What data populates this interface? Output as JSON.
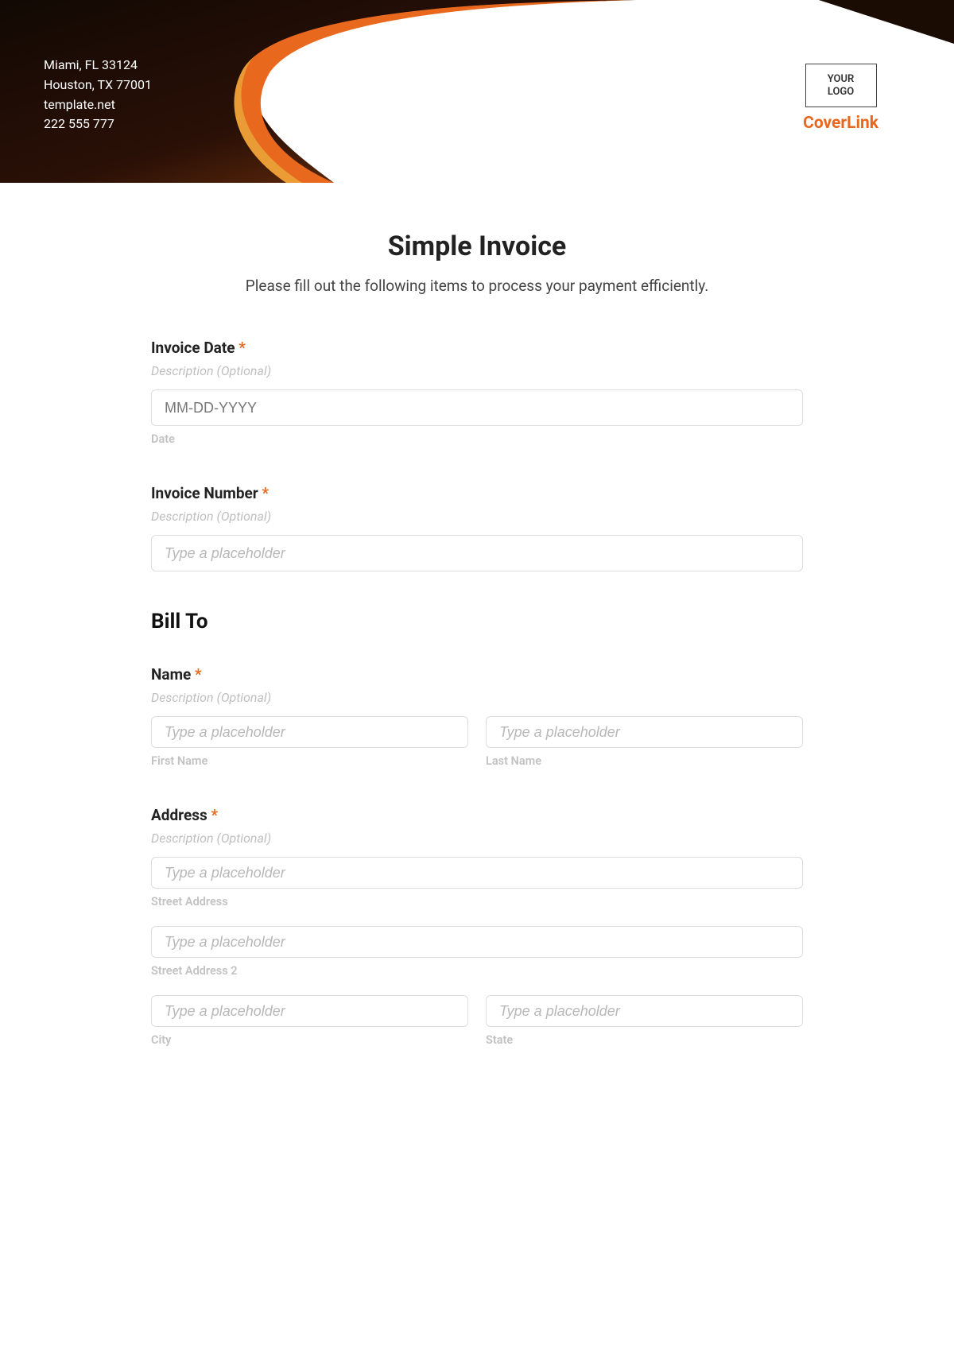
{
  "header": {
    "info_lines": [
      "Miami, FL 33124",
      "Houston, TX 77001",
      "template.net",
      "222 555 777"
    ],
    "logo_text": "YOUR\nLOGO",
    "brand": "CoverLink"
  },
  "form": {
    "title": "Simple Invoice",
    "subtitle": "Please fill out the following items to process your payment efficiently.",
    "invoice_date": {
      "label": "Invoice Date",
      "required": "*",
      "desc": "Description (Optional)",
      "placeholder": "MM-DD-YYYY",
      "sublabel": "Date"
    },
    "invoice_number": {
      "label": "Invoice Number",
      "required": "*",
      "desc": "Description (Optional)",
      "placeholder": "Type a placeholder"
    },
    "bill_to": {
      "heading": "Bill To",
      "name": {
        "label": "Name",
        "required": "*",
        "desc": "Description (Optional)",
        "first_placeholder": "Type a placeholder",
        "first_sublabel": "First Name",
        "last_placeholder": "Type a placeholder",
        "last_sublabel": "Last Name"
      },
      "address": {
        "label": "Address",
        "required": "*",
        "desc": "Description (Optional)",
        "street_placeholder": "Type a placeholder",
        "street_sublabel": "Street Address",
        "street2_placeholder": "Type a placeholder",
        "street2_sublabel": "Street Address 2",
        "city_placeholder": "Type a placeholder",
        "city_sublabel": "City",
        "state_placeholder": "Type a placeholder",
        "state_sublabel": "State"
      }
    }
  }
}
